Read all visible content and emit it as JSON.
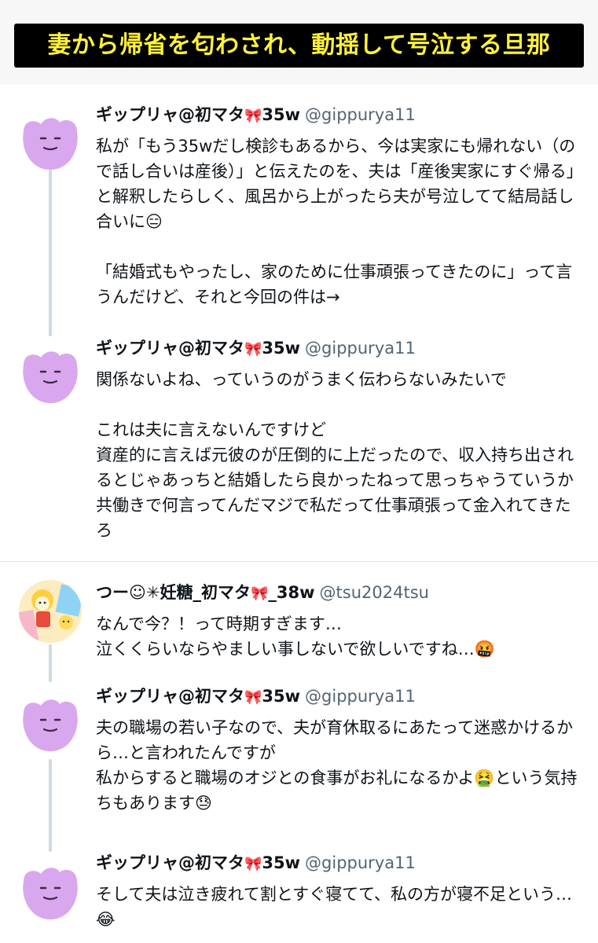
{
  "banner": {
    "title": "妻から帰省を匂わされ、動揺して号泣する旦那"
  },
  "posts": [
    {
      "name": "ギップリャ@初マタ",
      "ribbon": "🎀",
      "weeks": "35w",
      "handle": "@gippurya11",
      "text": "私が「もう35wだし検診もあるから、今は実家にも帰れない（ので話し合いは産後）」と伝えたのを、夫は「産後実家にすぐ帰る」と解釈したらしく、風呂から上がったら夫が号泣してて結局話し合いに😑\n\n「結婚式もやったし、家のために仕事頑張ってきたのに」って言うんだけど、それと今回の件は→"
    },
    {
      "name": "ギップリャ@初マタ",
      "ribbon": "🎀",
      "weeks": "35w",
      "handle": "@gippurya11",
      "text": "関係ないよね、っていうのがうまく伝わらないみたいで\n\nこれは夫に言えないんですけど\n資産的に言えば元彼のが圧倒的に上だったので、収入持ち出されるとじゃあっちと結婚したら良かったねって思っちゃうていうか共働きで何言ってんだマジで私だって仕事頑張って金入れてきたろ"
    },
    {
      "name": "つー☺︎✳︎妊糖_初マタ",
      "ribbon": "🎀",
      "weeks": "_38w",
      "handle": "@tsu2024tsu",
      "text": "なんで今？！って時期すぎます…\n泣くくらいならやましい事しないで欲しいですね…🤬"
    },
    {
      "name": "ギップリャ@初マタ",
      "ribbon": "🎀",
      "weeks": "35w",
      "handle": "@gippurya11",
      "text": "夫の職場の若い子なので、夫が育休取るにあたって迷惑かけるから…と言われたんですが\n私からすると職場のオジとの食事がお礼になるかよ🤮という気持ちもあります😓"
    },
    {
      "name": "ギップリャ@初マタ",
      "ribbon": "🎀",
      "weeks": "35w",
      "handle": "@gippurya11",
      "text": "そして夫は泣き疲れて割とすぐ寝てて、私の方が寝不足という…😂"
    }
  ],
  "colors": {
    "ditto_purple": "#d9a7ee",
    "ditto_face": "#3b2a46",
    "banner_text": "#fff13a",
    "handle_gray": "#536471",
    "thread_line": "#cfd9de"
  },
  "icons": {
    "gippurya_avatar": "ditto-avatar-icon",
    "tsu_avatar": "character-sticker-avatar-icon"
  }
}
